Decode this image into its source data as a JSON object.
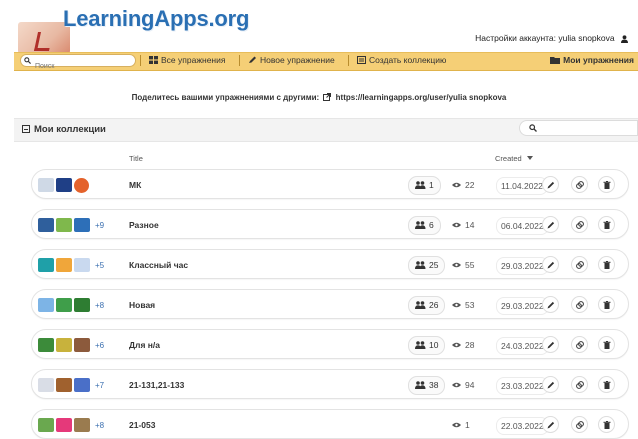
{
  "header": {
    "logo_text": "LearningApps.org",
    "account_text": "Настройки аккаунта: yulia snopkova"
  },
  "toolbar": {
    "search_placeholder": "Поиск",
    "all_exercises": "Все упражнения",
    "new_exercise": "Новое упражнение",
    "create_collection": "Создать коллекцию",
    "my_exercises": "Мои упражнения"
  },
  "share": {
    "label": "Поделитесь вашими упражнениями с другими:",
    "url": "https://learningapps.org/user/yulia snopkova"
  },
  "collections": {
    "title": "Мои коллекции",
    "col_title": "Title",
    "col_created": "Created"
  },
  "rows": [
    {
      "title": "МК",
      "users": "1",
      "views": "22",
      "date": "11.04.2022",
      "more": "",
      "thumbs": [
        "#cfd9e6",
        "#1f3f86",
        "#e4622b"
      ]
    },
    {
      "title": "Разное",
      "users": "6",
      "views": "14",
      "date": "06.04.2022",
      "more": "+9",
      "thumbs": [
        "#2f5f9c",
        "#7fb84c",
        "#2d6fb8"
      ]
    },
    {
      "title": "Классный час",
      "users": "25",
      "views": "55",
      "date": "29.03.2022",
      "more": "+5",
      "thumbs": [
        "#1fa0a8",
        "#f0a63a",
        "#c9d9ef"
      ]
    },
    {
      "title": "Новая",
      "users": "26",
      "views": "53",
      "date": "29.03.2022",
      "more": "+8",
      "thumbs": [
        "#7db4e6",
        "#3f9e4a",
        "#2e7d32"
      ]
    },
    {
      "title": "Для н/а",
      "users": "10",
      "views": "28",
      "date": "24.03.2022",
      "more": "+6",
      "thumbs": [
        "#3c8b3a",
        "#c8b23c",
        "#8c5a3c"
      ]
    },
    {
      "title": "21-131,21-133",
      "users": "38",
      "views": "94",
      "date": "23.03.2022",
      "more": "+7",
      "thumbs": [
        "#d9dde6",
        "#a0612e",
        "#4a6fc8"
      ]
    },
    {
      "title": "21-053",
      "users": "",
      "views": "1",
      "date": "22.03.2022",
      "more": "+8",
      "thumbs": [
        "#6aa84f",
        "#e5397a",
        "#9a7b4f"
      ]
    }
  ]
}
